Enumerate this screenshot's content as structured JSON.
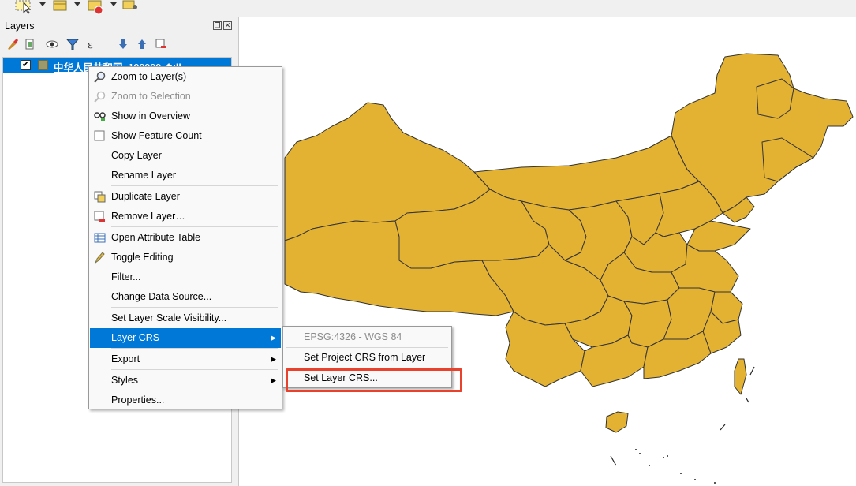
{
  "toolbar": {
    "icons": [
      "select-features-icon",
      "attribute-table-icon",
      "deselect-icon",
      "label-pin-icon"
    ]
  },
  "layers_panel": {
    "title": "Layers",
    "tools": [
      "style-manager-icon",
      "add-group-icon",
      "visibility-icon",
      "filter-legend-icon",
      "filter-expression-icon",
      "expand-all-icon",
      "collapse-all-icon",
      "remove-layer-icon"
    ],
    "layer": {
      "name": "中华人民共和国_100000_full",
      "checked": "✔",
      "checked_state": true
    }
  },
  "context_menu": {
    "items": [
      {
        "label": "Zoom to Layer(s)",
        "icon": "zoom-layer-icon",
        "enabled": true
      },
      {
        "label": "Zoom to Selection",
        "icon": "zoom-selection-icon",
        "enabled": false
      },
      {
        "label": "Show in Overview",
        "icon": "overview-icon",
        "enabled": true
      },
      {
        "label": "Show Feature Count",
        "icon": "checkbox-icon",
        "enabled": true
      },
      {
        "label": "Copy Layer",
        "enabled": true
      },
      {
        "label": "Rename Layer",
        "enabled": true
      },
      {
        "label": "Duplicate Layer",
        "icon": "duplicate-icon",
        "enabled": true
      },
      {
        "label": "Remove Layer…",
        "icon": "remove-icon",
        "enabled": true
      },
      {
        "label": "Open Attribute Table",
        "icon": "table-icon",
        "enabled": true
      },
      {
        "label": "Toggle Editing",
        "icon": "pencil-icon",
        "enabled": true
      },
      {
        "label": "Filter...",
        "enabled": true
      },
      {
        "label": "Change Data Source...",
        "enabled": true
      },
      {
        "label": "Set Layer Scale Visibility...",
        "enabled": true
      },
      {
        "label": "Layer CRS",
        "submenu": true,
        "highlighted": true
      },
      {
        "label": "Export",
        "submenu": true
      },
      {
        "label": "Styles",
        "submenu": true
      },
      {
        "label": "Properties...",
        "enabled": true
      }
    ]
  },
  "submenu": {
    "items": [
      {
        "label": "EPSG:4326 - WGS 84",
        "enabled": false
      },
      {
        "label": "Set Project CRS from Layer",
        "enabled": true
      },
      {
        "label": "Set Layer CRS...",
        "enabled": true
      }
    ]
  },
  "map": {
    "fill_color": "#e3b233",
    "stroke_color": "#333333"
  },
  "highlight_color": "#e8412c"
}
